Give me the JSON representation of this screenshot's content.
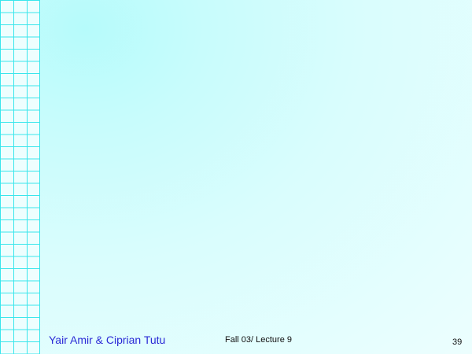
{
  "slide": {
    "footer": {
      "author": "Yair Amir & Ciprian Tutu",
      "course": "Fall 03/ Lecture 9",
      "page_number": "39"
    },
    "colors": {
      "background_light": "#ecfefe",
      "background_cyan": "#b6fbfb",
      "grid_line": "#39e6ec",
      "author_text": "#2a2ad6",
      "footer_text": "#111111"
    }
  }
}
